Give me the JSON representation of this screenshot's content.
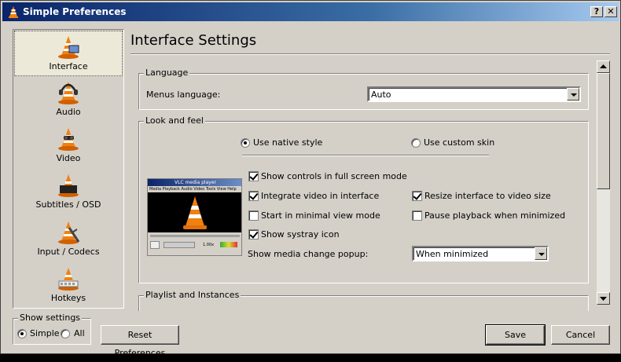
{
  "window": {
    "title": "Simple Preferences"
  },
  "titlebar_buttons": {
    "help": "?",
    "close": "✕"
  },
  "sidebar": {
    "items": [
      {
        "label": "Interface",
        "selected": true
      },
      {
        "label": "Audio"
      },
      {
        "label": "Video"
      },
      {
        "label": "Subtitles / OSD"
      },
      {
        "label": "Input / Codecs"
      },
      {
        "label": "Hotkeys"
      }
    ]
  },
  "show_settings": {
    "title": "Show settings",
    "simple": "Simple",
    "all": "All",
    "selected": "Simple"
  },
  "content": {
    "title": "Interface Settings",
    "language": {
      "group_title": "Language",
      "menus_language_label": "Menus language:",
      "menus_language_value": "Auto"
    },
    "look_and_feel": {
      "group_title": "Look and feel",
      "native_style": "Use native style",
      "custom_skin": "Use custom skin",
      "style_selected": "native",
      "show_controls_fullscreen": {
        "label": "Show controls in full screen mode",
        "checked": true
      },
      "integrate_video": {
        "label": "Integrate video in interface",
        "checked": true
      },
      "resize_interface": {
        "label": "Resize interface to video size",
        "checked": true
      },
      "minimal_view": {
        "label": "Start in minimal view mode",
        "checked": false
      },
      "pause_minimized": {
        "label": "Pause playback when minimized",
        "checked": false
      },
      "systray_icon": {
        "label": "Show systray icon",
        "checked": true
      },
      "media_popup_label": "Show media change popup:",
      "media_popup_value": "When minimized",
      "preview": {
        "title": "VLC media player",
        "menu": "Media  Playback  Audio  Video  Tools  View  Help",
        "time": "1.00x"
      }
    },
    "playlist": {
      "group_title": "Playlist and Instances"
    }
  },
  "buttons": {
    "reset": "Reset Preferences",
    "save": "Save",
    "cancel": "Cancel"
  },
  "colors": {
    "face": "#d4d0c8",
    "title_start": "#0a246a",
    "title_end": "#a6caf0",
    "cone_orange": "#f08010"
  }
}
